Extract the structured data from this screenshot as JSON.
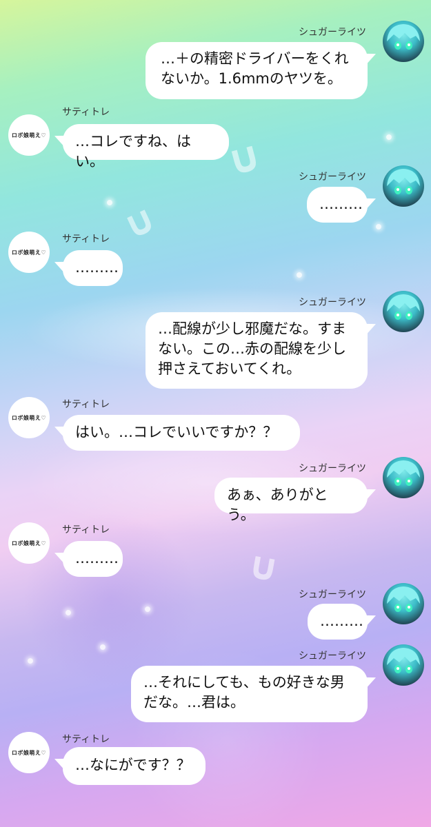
{
  "speakers": {
    "sugar": {
      "name": "シュガーライツ",
      "avatar_icon": "character-avatar-icon"
    },
    "sati": {
      "name": "サティトレ",
      "avatar_label": "ロボ娘萌え♡"
    }
  },
  "messages": [
    {
      "speaker": "sugar",
      "side": "right",
      "text": "…＋の精密ドライバーをくれないか。1.6mmのヤツを。"
    },
    {
      "speaker": "sati",
      "side": "left",
      "text": "…コレですね、はい。"
    },
    {
      "speaker": "sugar",
      "side": "right",
      "text": "………"
    },
    {
      "speaker": "sati",
      "side": "left",
      "text": "………"
    },
    {
      "speaker": "sugar",
      "side": "right",
      "text": "…配線が少し邪魔だな。すまない。この…赤の配線を少し押さえておいてくれ。"
    },
    {
      "speaker": "sati",
      "side": "left",
      "text": "はい。…コレでいいですか？？"
    },
    {
      "speaker": "sugar",
      "side": "right",
      "text": "あぁ、ありがとう。"
    },
    {
      "speaker": "sati",
      "side": "left",
      "text": "………"
    },
    {
      "speaker": "sugar",
      "side": "right",
      "text": "………"
    },
    {
      "speaker": "sugar",
      "side": "right",
      "text": "…それにしても、もの好きな男だな。…君は。"
    },
    {
      "speaker": "sati",
      "side": "left",
      "text": "…なにがです？？"
    }
  ]
}
